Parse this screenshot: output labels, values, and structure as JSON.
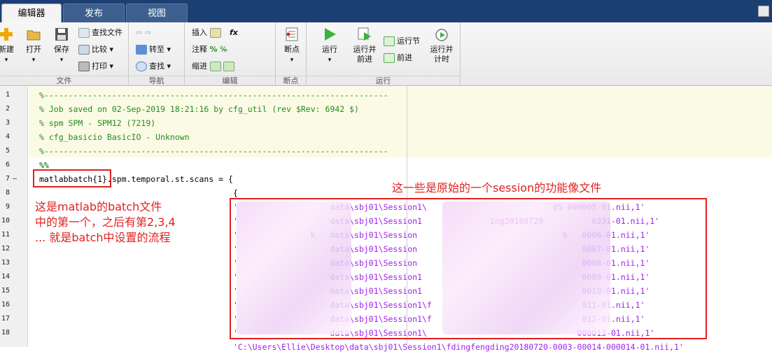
{
  "tabs": [
    "编辑器",
    "发布",
    "视图"
  ],
  "ribbon": {
    "file": {
      "new": "新建",
      "open": "打开",
      "save": "保存",
      "find_files": "查找文件",
      "compare": "比较",
      "print": "打印",
      "label": "文件"
    },
    "nav": {
      "goto": "转至",
      "find": "查找",
      "label": "导航"
    },
    "edit": {
      "insert": "插入",
      "comment": "注释",
      "indent": "缩进",
      "fx": "fx",
      "label": "编辑"
    },
    "breakpoints": {
      "breakpoint": "断点",
      "label": "断点"
    },
    "run": {
      "run": "运行",
      "run_advance_1": "运行并",
      "run_advance_2": "前进",
      "run_section": "运行节",
      "advance": "前进",
      "run_time_1": "运行并",
      "run_time_2": "计时",
      "label": "运行"
    }
  },
  "code_lines": [
    {
      "n": "1",
      "text": "%-----------------------------------------------------------------------",
      "cls": "cmt"
    },
    {
      "n": "2",
      "text": "% Job saved on 02-Sep-2019 18:21:16 by cfg_util (rev $Rev: 6942 $)",
      "cls": "cmt"
    },
    {
      "n": "3",
      "text": "% spm SPM - SPM12 (7219)",
      "cls": "cmt"
    },
    {
      "n": "4",
      "text": "% cfg_basicio BasicIO - Unknown",
      "cls": "cmt"
    },
    {
      "n": "5",
      "text": "%-----------------------------------------------------------------------",
      "cls": "cmt"
    },
    {
      "n": "6",
      "text": "%%",
      "cls": "cmt"
    },
    {
      "n": "7",
      "text": "matlabbatch{1}.spm.temporal.st.scans = {",
      "cls": ""
    },
    {
      "n": "8",
      "text": "                                        {",
      "cls": ""
    },
    {
      "n": "9",
      "text": "                                        '                   data\\sbj01\\Session1\\                          05-000005-01.nii,1'",
      "cls": "str"
    },
    {
      "n": "10",
      "text": "                                        '                   data\\sbj01\\Session1              ing20180720          0331-01.nii,1'",
      "cls": "str"
    },
    {
      "n": "11",
      "text": "                                        '               k   data\\sbj01\\Session                              6   0006-01.nii,1'",
      "cls": "str"
    },
    {
      "n": "12",
      "text": "                                        '                   data\\sbj01\\Session                                  0007-01.nii,1'",
      "cls": "str"
    },
    {
      "n": "13",
      "text": "                                        '                   data\\sbj01\\Session                                  0008-01.nii,1'",
      "cls": "str"
    },
    {
      "n": "14",
      "text": "                                        '                   data\\sbj01\\Session1                                 0009-01.nii,1'",
      "cls": "str"
    },
    {
      "n": "15",
      "text": "                                        '                   data\\sbj01\\Session1                                 0010-01.nii,1'",
      "cls": "str"
    },
    {
      "n": "16",
      "text": "                                        '                   data\\sbj01\\Session1\\f                               011-01.nii,1'",
      "cls": "str"
    },
    {
      "n": "17",
      "text": "                                        '                   data\\sbj01\\Session1\\f                               012-01.nii,1'",
      "cls": "str"
    },
    {
      "n": "18",
      "text": "                                        '                   data\\sbj01\\Session1\\                               000013-01.nii,1'",
      "cls": "str"
    },
    {
      "n": "",
      "text": "                                        'C:\\Users\\Ellie\\Desktop\\data\\sbj01\\Session1\\fdingfengding20180720-0003-00014-000014-01.nii,1'",
      "cls": "str"
    }
  ],
  "annotations": {
    "left_note": [
      "这是matlab的batch文件",
      "中的第一个，之后有第2,3,4",
      "... 就是batch中设置的流程"
    ],
    "right_note": "这一些是原始的一个session的功能像文件"
  }
}
